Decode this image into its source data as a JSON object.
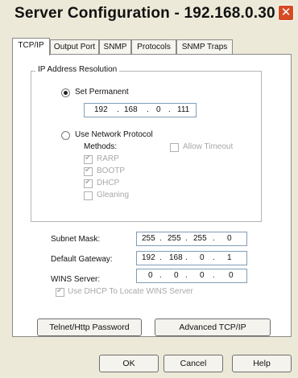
{
  "window": {
    "title": "Server Configuration - 192.168.0.30",
    "close_glyph": "✕"
  },
  "tabs": [
    {
      "label": "TCP/IP",
      "active": true
    },
    {
      "label": "Output Port",
      "active": false
    },
    {
      "label": "SNMP",
      "active": false
    },
    {
      "label": "Protocols",
      "active": false
    },
    {
      "label": "SNMP Traps",
      "active": false
    }
  ],
  "ip_resolution": {
    "legend": "IP Address Resolution",
    "set_permanent": {
      "label": "Set Permanent",
      "selected": true
    },
    "permanent_ip": [
      "192",
      "168",
      "0",
      "111"
    ],
    "use_network_protocol": {
      "label": "Use Network Protocol",
      "selected": false
    },
    "methods_label": "Methods:",
    "allow_timeout": {
      "label": "Allow Timeout",
      "checked": false
    },
    "methods": [
      {
        "label": "RARP",
        "checked": true
      },
      {
        "label": "BOOTP",
        "checked": true
      },
      {
        "label": "DHCP",
        "checked": true
      },
      {
        "label": "Gleaning",
        "checked": false
      }
    ]
  },
  "network": {
    "subnet_mask": {
      "label": "Subnet Mask:",
      "value": [
        "255",
        "255",
        "255",
        "0"
      ]
    },
    "default_gateway": {
      "label": "Default Gateway:",
      "value": [
        "192",
        "168",
        "0",
        "1"
      ]
    },
    "wins_server": {
      "label": "WINS Server:",
      "value": [
        "0",
        "0",
        "0",
        "0"
      ]
    },
    "use_dhcp_wins": {
      "label": "Use DHCP To Locate WINS Server",
      "checked": true
    }
  },
  "buttons": {
    "telnet_password": "Telnet/Http Password",
    "advanced_tcpip": "Advanced TCP/IP",
    "ok": "OK",
    "cancel": "Cancel",
    "help": "Help"
  },
  "icons": {
    "close": "close-icon",
    "checkmark": "checkmark-icon"
  },
  "colors": {
    "close_button": "#d64a24",
    "dialog_bg": "#ece9d8",
    "field_border": "#7f9db9"
  }
}
